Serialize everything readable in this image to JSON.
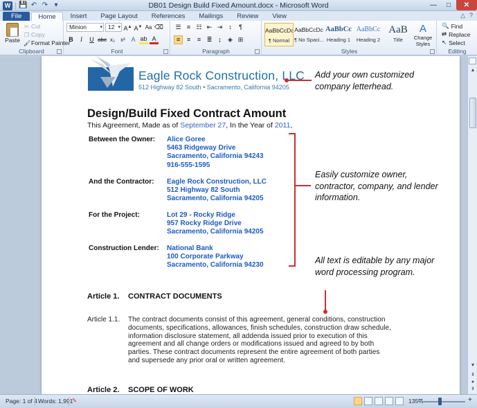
{
  "window": {
    "title": "DB01 Design Build Fixed Amount.docx - Microsoft Word",
    "controls": {
      "minimize": "—",
      "maximize": "□",
      "close": "✕"
    }
  },
  "quick_access": {
    "app_letter": "W",
    "save": "💾",
    "undo": "↶",
    "redo": "↷",
    "customize": "▾"
  },
  "tabs": [
    "File",
    "Home",
    "Insert",
    "Page Layout",
    "References",
    "Mailings",
    "Review",
    "View"
  ],
  "active_tab": "Home",
  "ribbon": {
    "clipboard": {
      "label": "Clipboard",
      "paste": "Paste",
      "cut": "Cut",
      "copy": "Copy",
      "format_painter": "Format Painter"
    },
    "font": {
      "label": "Font",
      "name": "Minion",
      "size": "12"
    },
    "paragraph": {
      "label": "Paragraph"
    },
    "styles": {
      "label": "Styles",
      "items": [
        {
          "sample": "AaBbCcDc",
          "name": "¶ Normal"
        },
        {
          "sample": "AaBbCcDc",
          "name": "¶ No Spaci..."
        },
        {
          "sample": "AaBbCc",
          "name": "Heading 1"
        },
        {
          "sample": "AaBbCc",
          "name": "Heading 2"
        },
        {
          "sample": "AaB",
          "name": "Title"
        }
      ],
      "change_styles": "Change Styles"
    },
    "editing": {
      "label": "Editing",
      "find": "Find",
      "replace": "Replace",
      "select": "Select"
    }
  },
  "document": {
    "letterhead": {
      "company": "Eagle Rock Construction, LLC",
      "address": "512 Highway 82 South • Sacramento, California 94205"
    },
    "title": "Design/Build Fixed Contract Amount",
    "subtitle": {
      "prefix": "This Agreement, Made as of ",
      "date": "September 27",
      "mid": ", In the Year of ",
      "year": "2011",
      "suffix": ","
    },
    "parties": [
      {
        "label": "Between the Owner:",
        "lines": [
          "Alice Goree",
          "5463 Ridgeway Drive",
          "Sacramento, California 94243",
          "916-555-1595"
        ]
      },
      {
        "label": "And the Contractor:",
        "lines": [
          "Eagle Rock Construction, LLC",
          "512 Highway 82 South",
          "Sacramento, California 94205"
        ]
      },
      {
        "label": "For the Project:",
        "lines": [
          "Lot 29 - Rocky Ridge",
          "957 Rocky Ridge Drive",
          "Sacramento, California 94205"
        ]
      },
      {
        "label": "Construction Lender:",
        "lines": [
          "National Bank",
          "100 Corporate Parkway",
          "Sacramento, California 94230"
        ]
      }
    ],
    "article1": {
      "number": "Article 1.",
      "title": "CONTRACT DOCUMENTS",
      "sub_number": "Article 1.1.",
      "body": "The contract documents consist of this agreement, general conditions, construction documents, specifications, allowances, finish schedules, construction draw schedule, information disclosure statement, all addenda issued prior to execution of this agreement and all change orders or modifications issued and agreed to by both parties.  These contract documents represent the entire agreement of both parties and supersede any prior oral or written agreement."
    },
    "article2": {
      "number": "Article 2.",
      "title": "SCOPE OF WORK"
    }
  },
  "callouts": {
    "letterhead": "Add your own customized company letterhead.",
    "info": "Easily customize owner, contractor, company, and lender information.",
    "editable": "All text is editable by any major word processing program."
  },
  "statusbar": {
    "page": "Page: 1 of 4",
    "words": "Words: 1,991",
    "zoom": "135%"
  },
  "colors": {
    "accent_red": "#c9302c",
    "field_blue": "#1d5bc4",
    "brand_blue": "#1f6fa8"
  }
}
